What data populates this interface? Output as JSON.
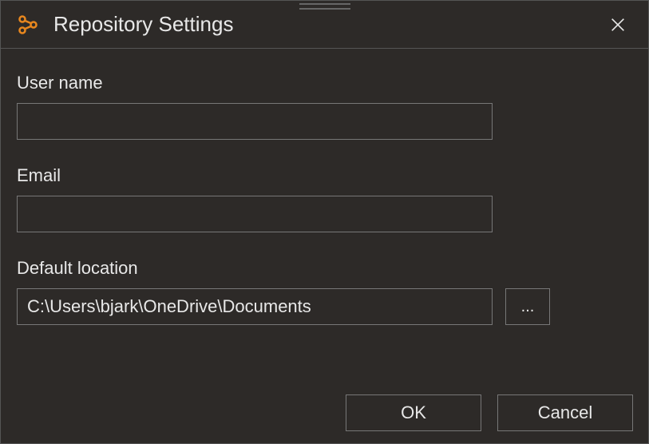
{
  "dialog": {
    "title": "Repository Settings"
  },
  "fields": {
    "username": {
      "label": "User name",
      "value": ""
    },
    "email": {
      "label": "Email",
      "value": ""
    },
    "defaultLocation": {
      "label": "Default location",
      "value": "C:\\Users\\bjark\\OneDrive\\Documents",
      "browseLabel": "..."
    }
  },
  "buttons": {
    "ok": "OK",
    "cancel": "Cancel"
  }
}
